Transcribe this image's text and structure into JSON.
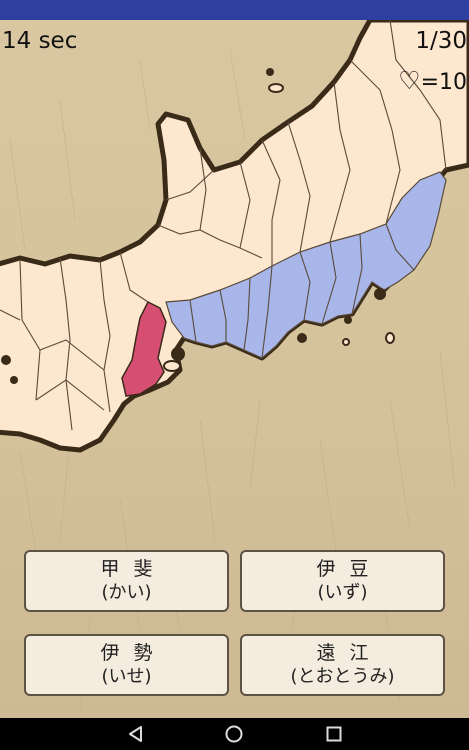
{
  "hud": {
    "timer": "14 sec",
    "progress": "1/30",
    "lives_icon": "heart-outline-icon",
    "lives_text": "=10"
  },
  "map": {
    "colors": {
      "land": "#fde7cf",
      "highlight": "#d64f73",
      "region": "#a8b6ea",
      "coast": "#3a2a18",
      "border": "#5a4a38"
    }
  },
  "answers": [
    {
      "kanji": "甲斐",
      "kana": "(かい)"
    },
    {
      "kanji": "伊豆",
      "kana": "(いず)"
    },
    {
      "kanji": "伊勢",
      "kana": "(いせ)"
    },
    {
      "kanji": "遠江",
      "kana": "(とおとうみ)"
    }
  ],
  "navbar": {
    "back": "back-triangle-icon",
    "home": "home-circle-icon",
    "recents": "recents-square-icon"
  }
}
